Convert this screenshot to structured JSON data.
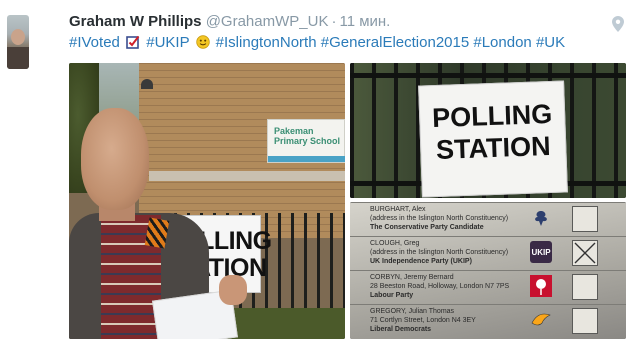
{
  "tweet": {
    "author_name": "Graham W Phillips",
    "handle": "@GrahamWP_UK",
    "separator": "·",
    "time": "11 мин.",
    "hashtags": [
      "#IVoted",
      "#UKIP",
      "#IslingtonNorth",
      "#GeneralElection2015",
      "#London",
      "#UK"
    ],
    "icons": {
      "location": "map-pin-icon",
      "ballot": "ballot-box-check-icon",
      "ukip_emoji": "smiley-emoji-icon"
    }
  },
  "photos": {
    "photo1": {
      "school_sign": "Pakeman Primary School",
      "polling_sign": [
        "POLLING",
        "STATION"
      ]
    },
    "photo2": {
      "polling_sign": [
        "POLLING",
        "STATION"
      ]
    },
    "photo3": {
      "candidates": [
        {
          "name": "BURGHART, Alex",
          "address": "(address in the Islington North Constituency)",
          "party": "The Conservative Party Candidate",
          "logo_label": "Conservatives"
        },
        {
          "name": "CLOUGH, Greg",
          "address": "(address in the Islington North Constituency)",
          "party": "UK Independence Party (UKIP)",
          "logo_label": "UKIP"
        },
        {
          "name": "CORBYN, Jeremy Bernard",
          "address": "28 Beeston Road, Holloway, London N7 7PS",
          "party": "Labour Party",
          "logo_label": "Labour"
        },
        {
          "name": "GREGORY, Julian Thomas",
          "address": "71 Cortlyn Street, London N4 3EY",
          "party": "Liberal Democrats",
          "logo_label": "Liberal Democrats"
        }
      ],
      "marked_box": "UKIP"
    }
  },
  "colors": {
    "name": "#292f33",
    "muted": "#8899a6",
    "link": "#2b7bb9"
  }
}
